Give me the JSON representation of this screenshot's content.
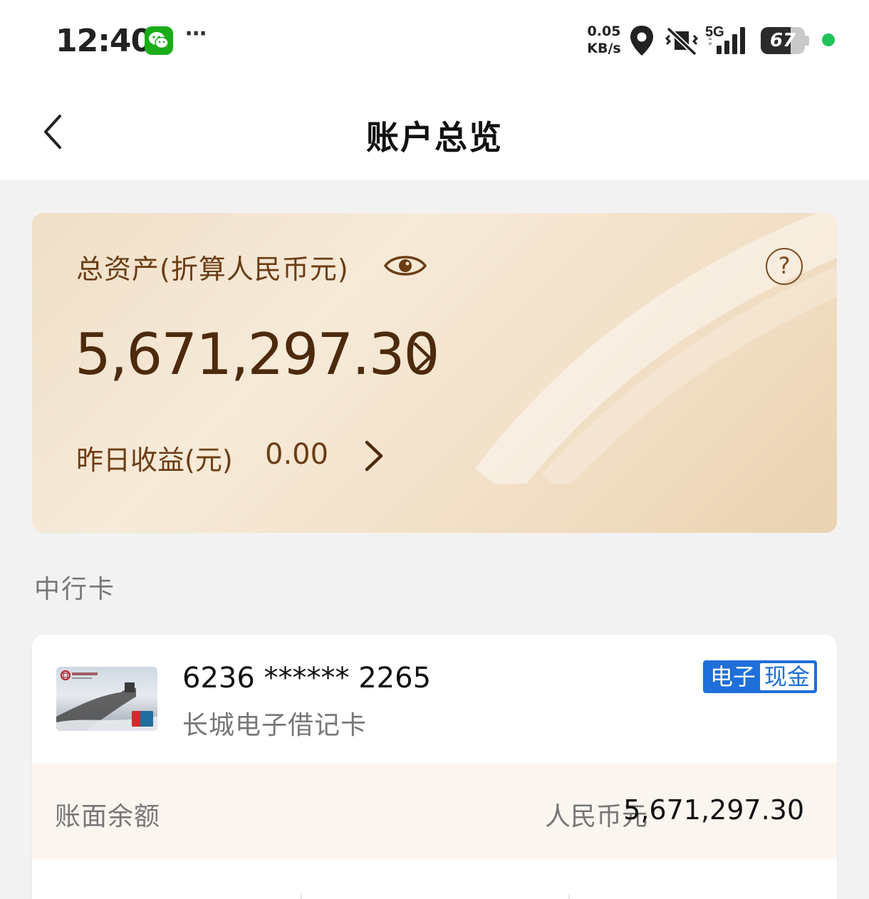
{
  "status_bar": {
    "time": "12:40",
    "net_speed_value": "0.05",
    "net_speed_unit": "KB/s",
    "network": "5G",
    "battery": "67",
    "battery_level": 0.67,
    "icons": [
      "wechat-icon",
      "more-icon",
      "location-icon",
      "mute-icon",
      "signal-icon",
      "battery-icon",
      "green-dot"
    ]
  },
  "nav": {
    "title": "账户总览",
    "back_icon": "chevron-left-icon"
  },
  "asset_card": {
    "label": "总资产(折算人民币元)",
    "amount": "5,671,297.30",
    "yesterday_label": "昨日收益(元)",
    "yesterday_value": "0.00",
    "help_symbol": "?"
  },
  "section": {
    "title": "中行卡"
  },
  "card": {
    "number": "6236 ****** 2265",
    "name": "长城电子借记卡",
    "tag_primary": "电子",
    "tag_secondary": "现金",
    "balance_label": "账面余额",
    "balance_currency": "人民币元",
    "balance_amount": "5,671,297.30"
  },
  "colors": {
    "accent_blue": "#1e6fd9",
    "gold_text": "#6b3d14",
    "card_bg": "#f3e2ca"
  }
}
